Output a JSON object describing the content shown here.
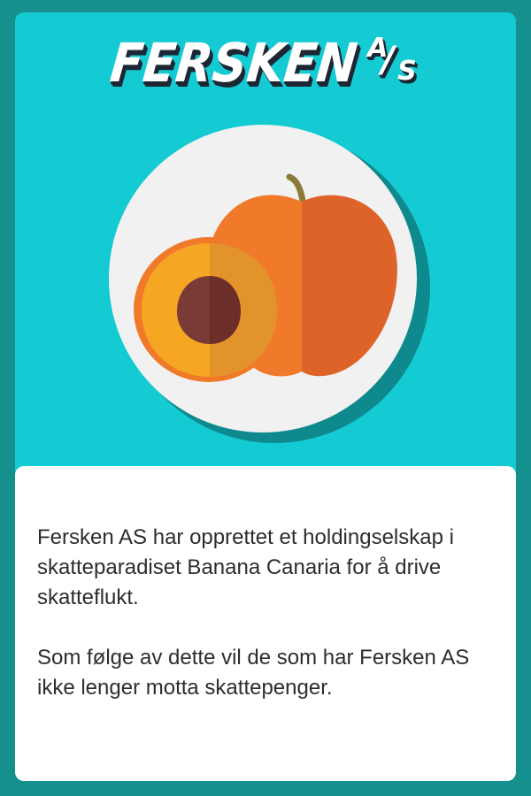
{
  "title": {
    "main": "FERSKEN",
    "suffix_a": "A",
    "suffix_slash": "/",
    "suffix_s": "S"
  },
  "description": {
    "paragraph_1": "Fersken AS har opprettet et holdingselskap i skatteparadiset Banana Canaria for å drive skatteflukt.",
    "paragraph_2": "Som følge av dette vil de som har Fersken AS ikke lenger motta skattepenger."
  },
  "colors": {
    "frame": "#15908f",
    "panel": "#14cbd4",
    "plate": "#f1f1f1",
    "plate_shadow": "#0e8a8f",
    "peach_light": "#f07a2a",
    "peach_dark": "#dd6329",
    "flesh_light": "#f5a623",
    "flesh_dark": "#e3932b",
    "pit_light": "#7a3a35",
    "pit_dark": "#6b2e29",
    "stem": "#8a7b3a"
  },
  "icons": {
    "illustration": "peach-on-plate-icon"
  }
}
